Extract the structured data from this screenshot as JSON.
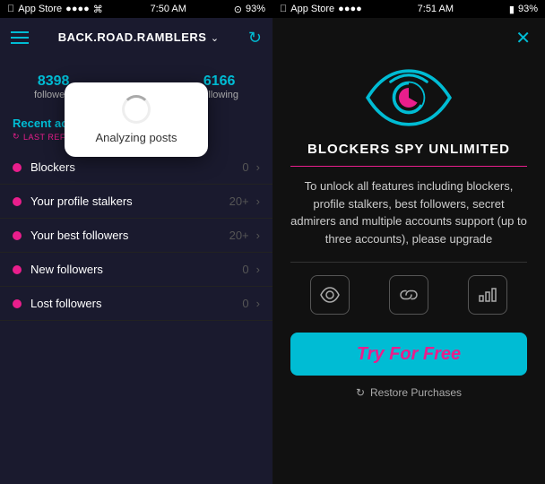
{
  "left": {
    "status_bar": {
      "store": "App Store",
      "signal": "●●●●",
      "wifi": "WiFi",
      "time": "7:50 AM",
      "battery_icon": "battery",
      "battery": "93%"
    },
    "header": {
      "title": "BACK.ROAD.RAMBLERS",
      "chevron": "∨"
    },
    "stats": {
      "followers_count": "8398",
      "followers_label": "followers",
      "following_count": "6166",
      "following_label": "following"
    },
    "analyzing": {
      "text": "Analyzing posts"
    },
    "recent_activity": {
      "title": "Recent activity",
      "subtitle": "LAST REFRESH: JUST NOW"
    },
    "activity_items": [
      {
        "label": "Blockers",
        "count": "0"
      },
      {
        "label": "Your profile stalkers",
        "count": "20+"
      },
      {
        "label": "Your best followers",
        "count": "20+"
      },
      {
        "label": "New followers",
        "count": "0"
      },
      {
        "label": "Lost followers",
        "count": "0"
      }
    ]
  },
  "right": {
    "status_bar": {
      "store": "App Store",
      "signal": "●●●●",
      "wifi": "WiFi",
      "time": "7:51 AM",
      "battery": "93%"
    },
    "product": {
      "title": "BLOCKERS SPY UNLIMITED",
      "description": "To unlock all features including blockers, profile stalkers, best followers, secret admirers and multiple accounts support (up to three accounts), please upgrade"
    },
    "try_free_label": "Try For Free",
    "restore_label": "Restore Purchases",
    "feature_icons": [
      "eye",
      "link",
      "bar-chart"
    ]
  },
  "colors": {
    "cyan": "#00bcd4",
    "pink": "#e91e8c",
    "dark_bg": "#1a1a2e",
    "darker_bg": "#111"
  }
}
